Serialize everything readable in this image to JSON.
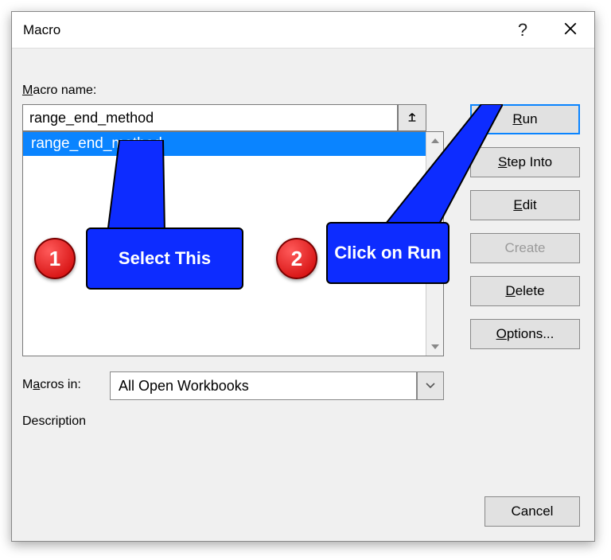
{
  "dialog": {
    "title": "Macro",
    "help": "?"
  },
  "labels": {
    "macro_name": "Macro name:",
    "macros_in": "Macros in:",
    "description": "Description"
  },
  "macro_name_value": "range_end_method",
  "macro_list": {
    "selected": "range_end_method"
  },
  "macros_in_dropdown": {
    "selected": "All Open Workbooks"
  },
  "buttons": {
    "run_pre": "",
    "run_u": "R",
    "run_post": "un",
    "step_pre": "",
    "step_u": "S",
    "step_post": "tep Into",
    "edit_pre": "",
    "edit_u": "E",
    "edit_post": "dit",
    "create": "Create",
    "delete_pre": "",
    "delete_u": "D",
    "delete_post": "elete",
    "options_pre": "",
    "options_u": "O",
    "options_post": "ptions...",
    "cancel": "Cancel"
  },
  "annotations": {
    "step1": "1",
    "step1_text": "Select This",
    "step2": "2",
    "step2_text": "Click on Run"
  }
}
